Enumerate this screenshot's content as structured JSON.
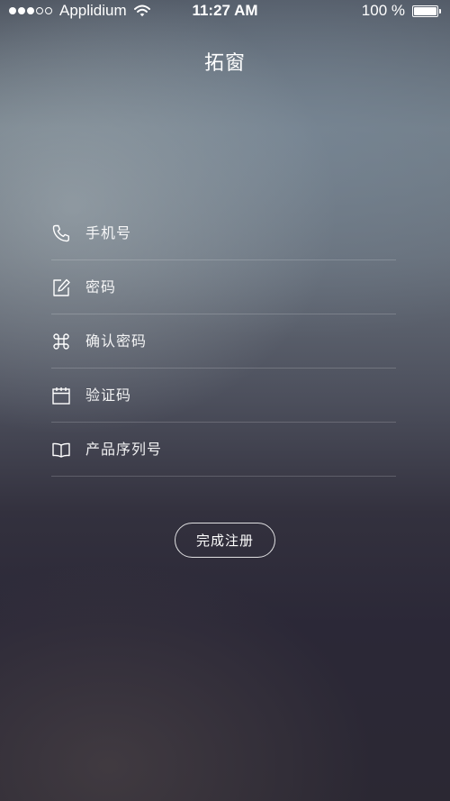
{
  "status_bar": {
    "carrier": "Applidium",
    "time": "11:27 AM",
    "battery_text": "100 %",
    "battery_level": 1.0,
    "signal_strength": 3,
    "signal_max": 5,
    "wifi_icon": "wifi-icon"
  },
  "header": {
    "title": "拓窗"
  },
  "form": {
    "fields": [
      {
        "icon": "phone-icon",
        "placeholder": "手机号",
        "value": ""
      },
      {
        "icon": "edit-icon",
        "placeholder": "密码",
        "value": ""
      },
      {
        "icon": "command-icon",
        "placeholder": "确认密码",
        "value": ""
      },
      {
        "icon": "calendar-icon",
        "placeholder": "验证码",
        "value": ""
      },
      {
        "icon": "book-icon",
        "placeholder": "产品序列号",
        "value": ""
      }
    ]
  },
  "submit": {
    "label": "完成注册"
  },
  "colors": {
    "text": "#ffffff",
    "divider": "rgba(255,255,255,0.18)",
    "background_top": "#707c86",
    "background_bottom": "#2b2833"
  }
}
